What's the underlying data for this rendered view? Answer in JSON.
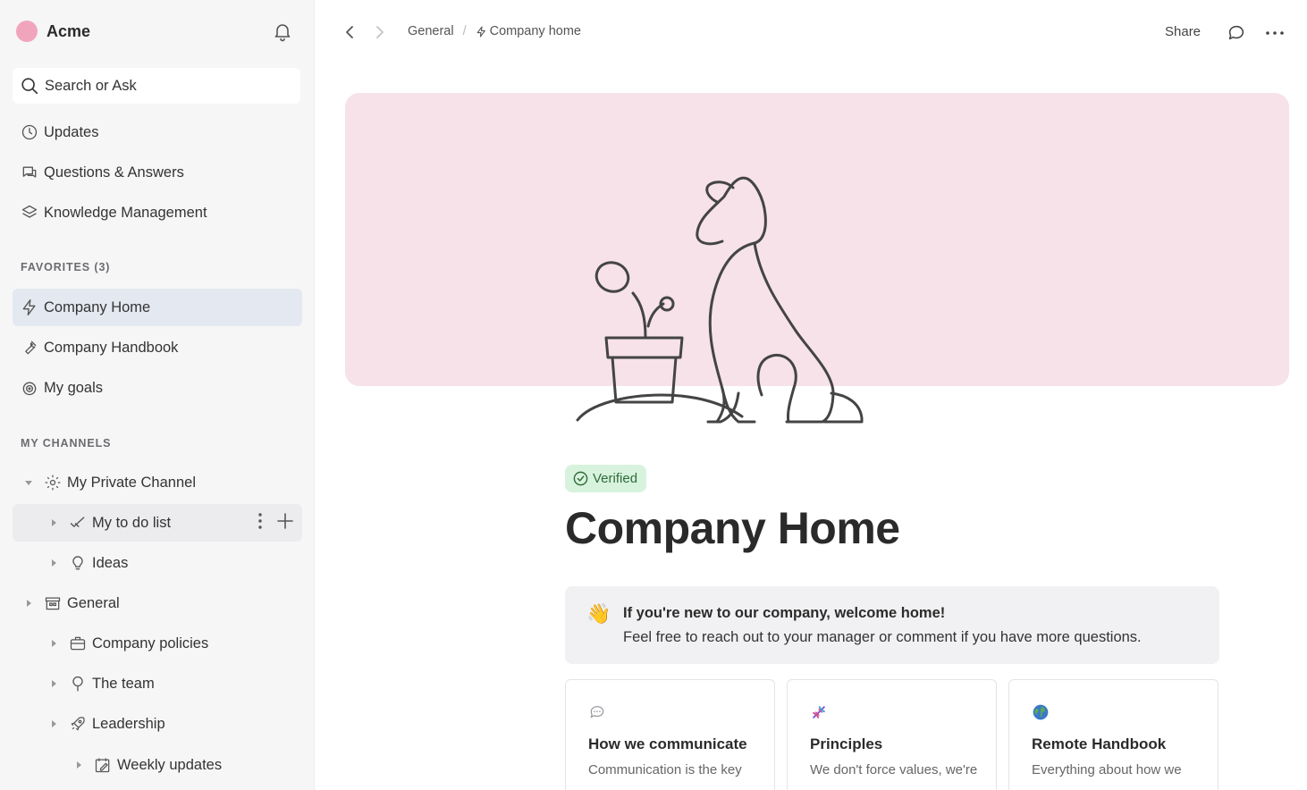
{
  "workspace": {
    "name": "Acme",
    "avatar_color": "#f0a5bd"
  },
  "search": {
    "label": "Search or Ask"
  },
  "nav": {
    "updates": "Updates",
    "qa": "Questions & Answers",
    "km": "Knowledge Management"
  },
  "favorites": {
    "header": "FAVORITES (3)",
    "items": [
      "Company Home",
      "Company Handbook",
      "My goals"
    ]
  },
  "channels": {
    "header": "MY CHANNELS",
    "items": [
      "My Private Channel",
      "My to do list",
      "Ideas",
      "General",
      "Company policies",
      "The team",
      "Leadership",
      "Weekly updates"
    ]
  },
  "breadcrumb": {
    "parent": "General",
    "separator": "/",
    "current": "Company home"
  },
  "topbar": {
    "share": "Share"
  },
  "page": {
    "verified": "Verified",
    "title": "Company Home",
    "cover_color": "#f6e2e8"
  },
  "callout": {
    "emoji": "👋",
    "title": "If you're new to our company, welcome home!",
    "body": "Feel free to reach out to your manager or comment if you have more questions."
  },
  "cards": [
    {
      "icon": "speech-bubble-icon",
      "title": "How we communicate",
      "desc": "Communication is the key"
    },
    {
      "icon": "dna-icon",
      "title": "Principles",
      "desc": "We don't force values, we're"
    },
    {
      "icon": "globe-icon",
      "title": "Remote Handbook",
      "desc": "Everything about how we"
    }
  ],
  "colors": {
    "accent_active": "#e4e8f0",
    "verified_bg": "#d8f3dd",
    "verified_text": "#2f6b3a"
  }
}
